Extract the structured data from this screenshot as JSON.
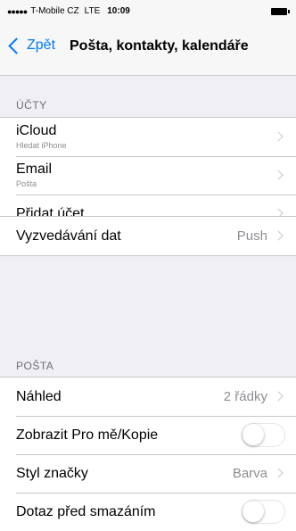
{
  "status_bar": {
    "signal_dots": "●●●●●",
    "carrier": "T-Mobile CZ",
    "network": "LTE",
    "time": "10:09"
  },
  "nav": {
    "back_label": "Zpět",
    "title": "Pošta, kontakty, kalendáře"
  },
  "accounts": {
    "header": "ÚČTY",
    "items": [
      {
        "title": "iCloud",
        "subtitle": "Hledat iPhone"
      },
      {
        "title": "Email",
        "subtitle": "Pošta"
      },
      {
        "title": "Přidat účet"
      }
    ]
  },
  "fetch": {
    "title": "Vyzvedávání dat",
    "value": "Push"
  },
  "mail": {
    "header": "POŠTA",
    "preview": {
      "title": "Náhled",
      "value": "2 řádky"
    },
    "show_to_cc": {
      "title": "Zobrazit Pro mě/Kopie",
      "on": false
    },
    "flag_style": {
      "title": "Styl značky",
      "value": "Barva"
    },
    "ask_before_delete": {
      "title": "Dotaz před smazáním",
      "on": false
    }
  },
  "colors": {
    "accent": "#007aff",
    "background": "#efeff4",
    "secondary_text": "#8e8e93"
  }
}
